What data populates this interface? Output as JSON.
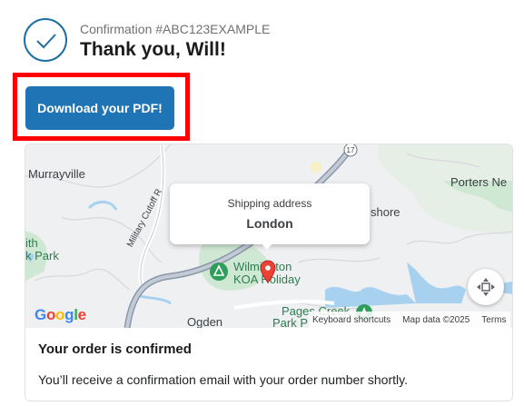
{
  "header": {
    "confirmation_number": "Confirmation #ABC123EXAMPLE",
    "thank_you": "Thank you, Will!",
    "check_icon": "checkmark-circle-icon",
    "accent_color": "#1f6fa3"
  },
  "actions": {
    "download_label": "Download your PDF!",
    "download_color": "#1f74b5",
    "highlight_color": "#ff0000"
  },
  "map": {
    "places": {
      "murrayville": "Murrayville",
      "porters_neck": "Porters Ne",
      "shore": "shore",
      "park_1": "ith",
      "park_2": "k Park",
      "wilmington": "Wilmington",
      "koa": "KOA Holiday",
      "pages_creek": "Pages Creek",
      "pages_creek_2": "Park P",
      "ogden": "Ogden",
      "cutoff_road": "Military Cutoff R",
      "route_badge": "17"
    },
    "tooltip": {
      "title": "Shipping address",
      "value": "London"
    },
    "google_logo": "Google",
    "attribution": {
      "shortcuts": "Keyboard shortcuts",
      "map_data": "Map data ©2025",
      "terms": "Terms"
    },
    "icons": {
      "pin": "map-pin-icon",
      "recenter": "recenter-icon",
      "campground": "campground-icon"
    }
  },
  "order": {
    "title": "Your order is confirmed",
    "message": "You’ll receive a confirmation email with your order number shortly."
  }
}
